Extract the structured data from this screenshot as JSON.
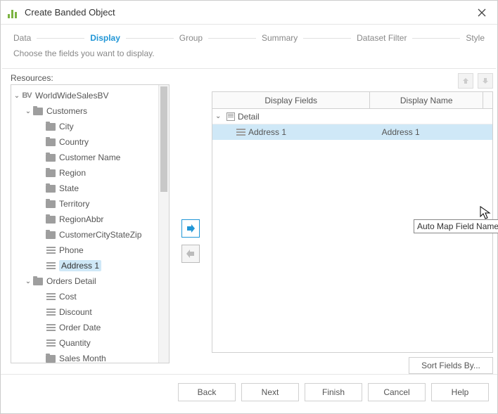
{
  "window": {
    "title": "Create Banded Object"
  },
  "wizard": {
    "steps": [
      "Data",
      "Display",
      "Group",
      "Summary",
      "Dataset Filter",
      "Style"
    ],
    "active_index": 1,
    "subtitle": "Choose the fields you want to display."
  },
  "resources": {
    "label": "Resources:",
    "root": {
      "label": "WorldWideSalesBV",
      "expanded": true,
      "children": [
        {
          "label": "Customers",
          "type": "folder",
          "expanded": true,
          "children": [
            {
              "label": "City",
              "type": "folder"
            },
            {
              "label": "Country",
              "type": "folder"
            },
            {
              "label": "Customer Name",
              "type": "folder"
            },
            {
              "label": "Region",
              "type": "folder"
            },
            {
              "label": "State",
              "type": "folder"
            },
            {
              "label": "Territory",
              "type": "folder"
            },
            {
              "label": "RegionAbbr",
              "type": "folder"
            },
            {
              "label": "CustomerCityStateZip",
              "type": "folder"
            },
            {
              "label": "Phone",
              "type": "field"
            },
            {
              "label": "Address 1",
              "type": "field",
              "selected": true
            }
          ]
        },
        {
          "label": "Orders Detail",
          "type": "folder",
          "expanded": true,
          "children": [
            {
              "label": "Cost",
              "type": "field"
            },
            {
              "label": "Discount",
              "type": "field"
            },
            {
              "label": "Order Date",
              "type": "field"
            },
            {
              "label": "Quantity",
              "type": "field"
            },
            {
              "label": "Sales Month",
              "type": "folder"
            }
          ]
        }
      ]
    }
  },
  "grid": {
    "col_fields": "Display Fields",
    "col_name": "Display Name",
    "rows": [
      {
        "kind": "group",
        "label": "Detail"
      },
      {
        "kind": "field",
        "label": "Address 1",
        "display_name": "Address 1",
        "selected": true
      }
    ],
    "sort_button": "Sort Fields By..."
  },
  "tooltip": "Auto Map Field Name",
  "buttons": {
    "back": "Back",
    "next": "Next",
    "finish": "Finish",
    "cancel": "Cancel",
    "help": "Help"
  }
}
